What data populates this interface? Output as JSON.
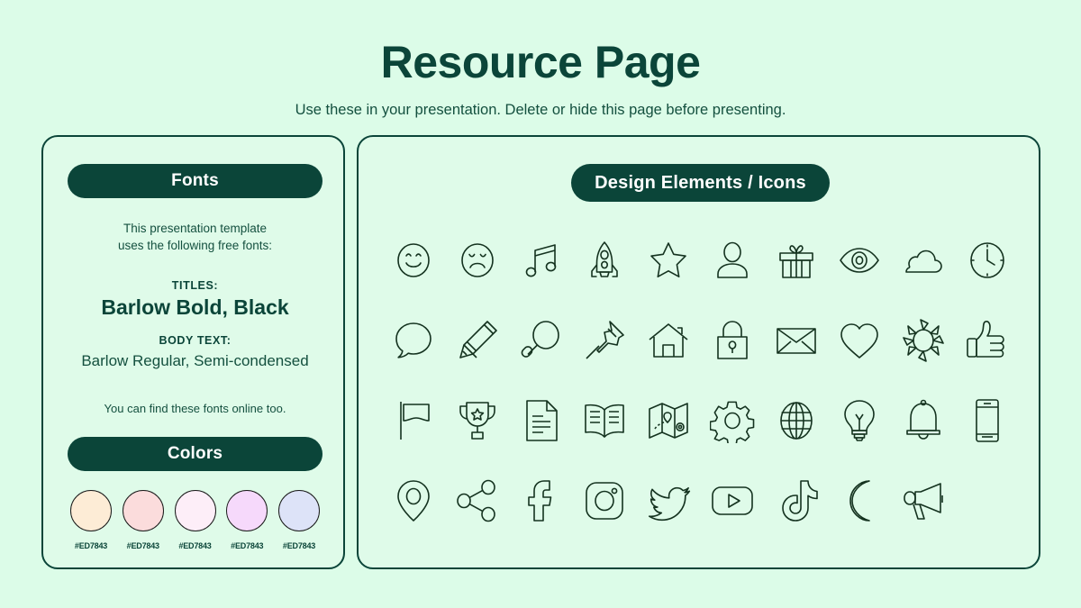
{
  "header": {
    "title": "Resource Page",
    "subtitle": "Use these in your presentation. Delete or hide this page before presenting."
  },
  "theme": {
    "background": "#dcfce8",
    "panel_background": "#dffbe9",
    "accent_dark": "#0b4539",
    "pill_text": "#ffffff",
    "icon_stroke": "#14321f"
  },
  "fonts_panel": {
    "heading": "Fonts",
    "intro_line1": "This presentation template",
    "intro_line2": "uses the following free fonts:",
    "titles_label": "TITLES:",
    "titles_value": "Barlow Bold, Black",
    "body_label": "BODY TEXT:",
    "body_value": "Barlow Regular, Semi-condensed",
    "note": "You can find these fonts online too."
  },
  "colors_panel": {
    "heading": "Colors",
    "swatches": [
      {
        "name": "swatch-1",
        "fill": "#fdecd6",
        "hex_label": "#ED7843"
      },
      {
        "name": "swatch-2",
        "fill": "#fbdcdc",
        "hex_label": "#ED7843"
      },
      {
        "name": "swatch-3",
        "fill": "#fdeef8",
        "hex_label": "#ED7843"
      },
      {
        "name": "swatch-4",
        "fill": "#f6d9fb",
        "hex_label": "#ED7843"
      },
      {
        "name": "swatch-5",
        "fill": "#dde3f8",
        "hex_label": "#ED7843"
      }
    ]
  },
  "icons_panel": {
    "heading": "Design Elements / Icons",
    "rows": 4,
    "columns": 10,
    "icons": [
      "smiley-face-icon",
      "sad-face-icon",
      "music-note-icon",
      "rocket-icon",
      "star-icon",
      "user-icon",
      "gift-icon",
      "eye-icon",
      "cloud-icon",
      "clock-icon",
      "speech-bubble-icon",
      "pencil-icon",
      "magnifying-glass-icon",
      "pushpin-icon",
      "house-icon",
      "lock-icon",
      "envelope-icon",
      "heart-icon",
      "sun-icon",
      "thumbs-up-icon",
      "flag-icon",
      "trophy-icon",
      "document-icon",
      "open-book-icon",
      "map-icon",
      "gear-icon",
      "globe-icon",
      "lightbulb-icon",
      "bell-icon",
      "smartphone-icon",
      "location-pin-icon",
      "share-icon",
      "facebook-icon",
      "instagram-icon",
      "twitter-icon",
      "youtube-icon",
      "tiktok-icon",
      "moon-icon",
      "megaphone-icon"
    ]
  }
}
